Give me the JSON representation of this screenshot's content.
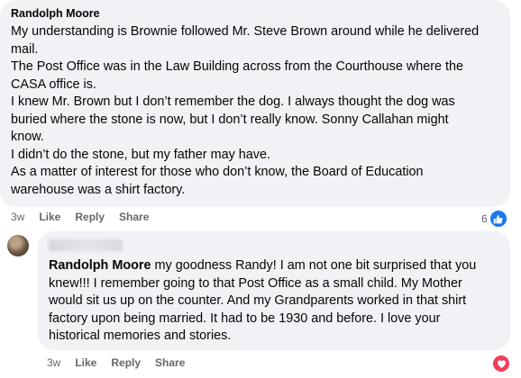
{
  "comment1": {
    "author": "Randolph Moore",
    "lines": [
      "My understanding is Brownie followed Mr. Steve Brown around while he delivered",
      "mail.",
      "The Post Office was in the Law Building across from the Courthouse where the",
      "CASA office is.",
      "I knew Mr. Brown but I don’t remember the dog. I always thought the dog was",
      "buried where the stone is now, but I don’t really know. Sonny Callahan might",
      "know.",
      "I didn’t do the stone, but my father may have.",
      "As a matter of interest for those who don’t know, the Board of Education",
      "warehouse was a shirt factory."
    ],
    "time": "3w",
    "like_label": "Like",
    "reply_label": "Reply",
    "share_label": "Share",
    "reaction_count": "6",
    "reaction_icon": "like-icon"
  },
  "comment2": {
    "mention": "Randolph Moore",
    "first_line_rest": " my goodness Randy! I am not one bit surprised that you",
    "lines": [
      "knew!!! I remember going to that Post Office as a small child. My Mother",
      "would sit us up on the counter. And my Grandparents worked in that shirt",
      "factory upon being married. It had to be 1930 and before. I love your",
      "historical memories and stories."
    ],
    "time": "3w",
    "like_label": "Like",
    "reply_label": "Reply",
    "share_label": "Share",
    "reaction_icon": "love-icon"
  },
  "colors": {
    "bubble": "#f0f2f5",
    "meta_text": "#65676b",
    "like_blue": "#1877f2",
    "love_red": "#f33e58"
  }
}
